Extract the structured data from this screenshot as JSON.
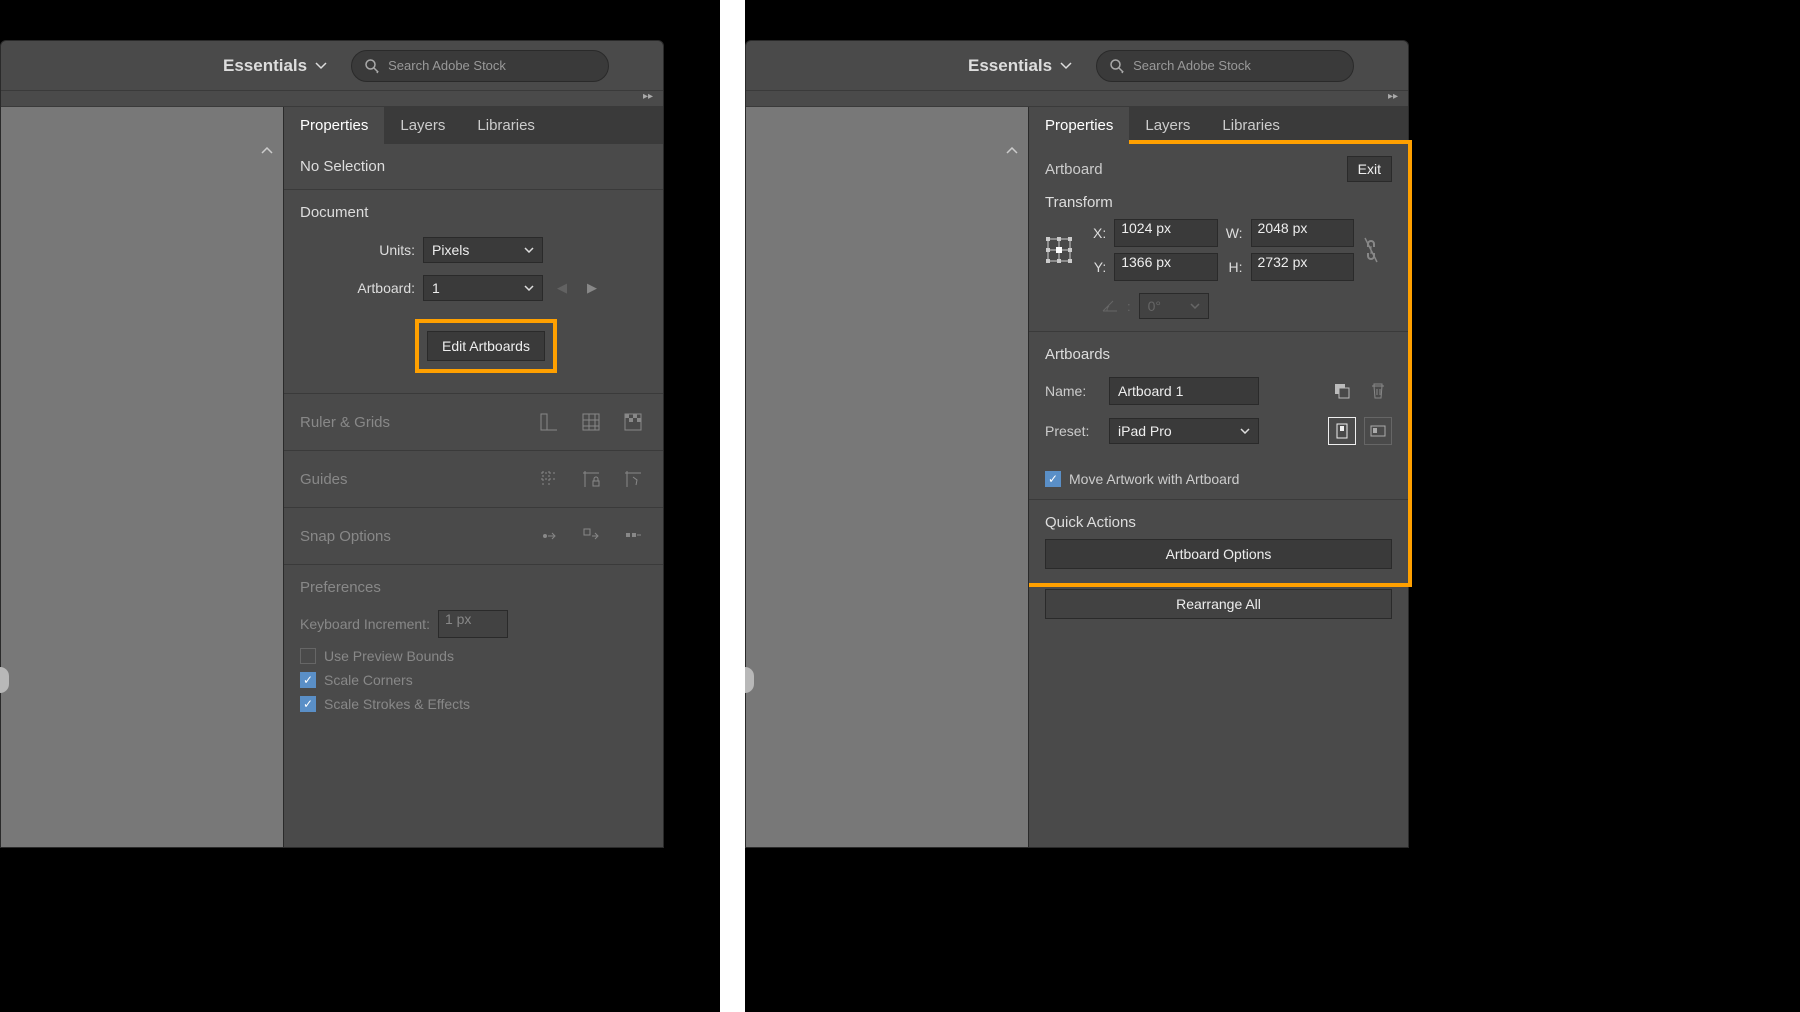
{
  "topbar": {
    "workspace": "Essentials",
    "search_placeholder": "Search Adobe Stock"
  },
  "tabs": {
    "properties": "Properties",
    "layers": "Layers",
    "libraries": "Libraries"
  },
  "left": {
    "no_selection": "No Selection",
    "document": "Document",
    "units_label": "Units:",
    "units_value": "Pixels",
    "artboard_label": "Artboard:",
    "artboard_value": "1",
    "edit_artboards": "Edit Artboards",
    "ruler_grids": "Ruler & Grids",
    "guides": "Guides",
    "snap_options": "Snap Options",
    "preferences": "Preferences",
    "kb_inc_label": "Keyboard Increment:",
    "kb_inc_value": "1 px",
    "use_preview_bounds": "Use Preview Bounds",
    "scale_corners": "Scale Corners",
    "scale_strokes": "Scale Strokes & Effects"
  },
  "right": {
    "artboard": "Artboard",
    "exit": "Exit",
    "transform": "Transform",
    "x_label": "X:",
    "x_value": "1024 px",
    "y_label": "Y:",
    "y_value": "1366 px",
    "w_label": "W:",
    "w_value": "2048 px",
    "h_label": "H:",
    "h_value": "2732 px",
    "angle_value": "0°",
    "artboards_section": "Artboards",
    "name_label": "Name:",
    "name_value": "Artboard 1",
    "preset_label": "Preset:",
    "preset_value": "iPad Pro",
    "move_artwork": "Move Artwork with Artboard",
    "quick_actions": "Quick Actions",
    "artboard_options": "Artboard Options",
    "rearrange_all": "Rearrange All"
  }
}
